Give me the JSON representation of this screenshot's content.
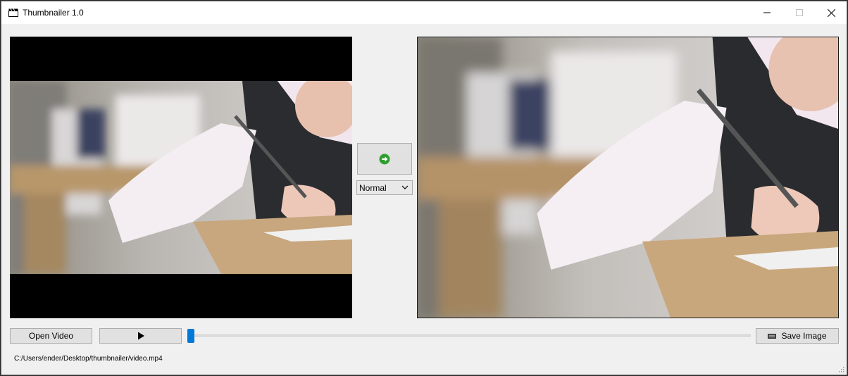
{
  "window": {
    "title": "Thumbnailer 1.0"
  },
  "controls": {
    "mode_selected": "Normal",
    "open_label": "Open Video",
    "save_label": "Save Image",
    "slider_position": 0.0
  },
  "status": {
    "file_path": "C:/Users/ender/Desktop/thumbnailer/video.mp4"
  },
  "icons": {
    "app": "clapperboard-icon",
    "arrow": "green-right-arrow-icon",
    "play": "play-icon",
    "save": "disk-icon"
  },
  "colors": {
    "accent": "#0078d7",
    "arrow_green": "#2f9e2f"
  }
}
